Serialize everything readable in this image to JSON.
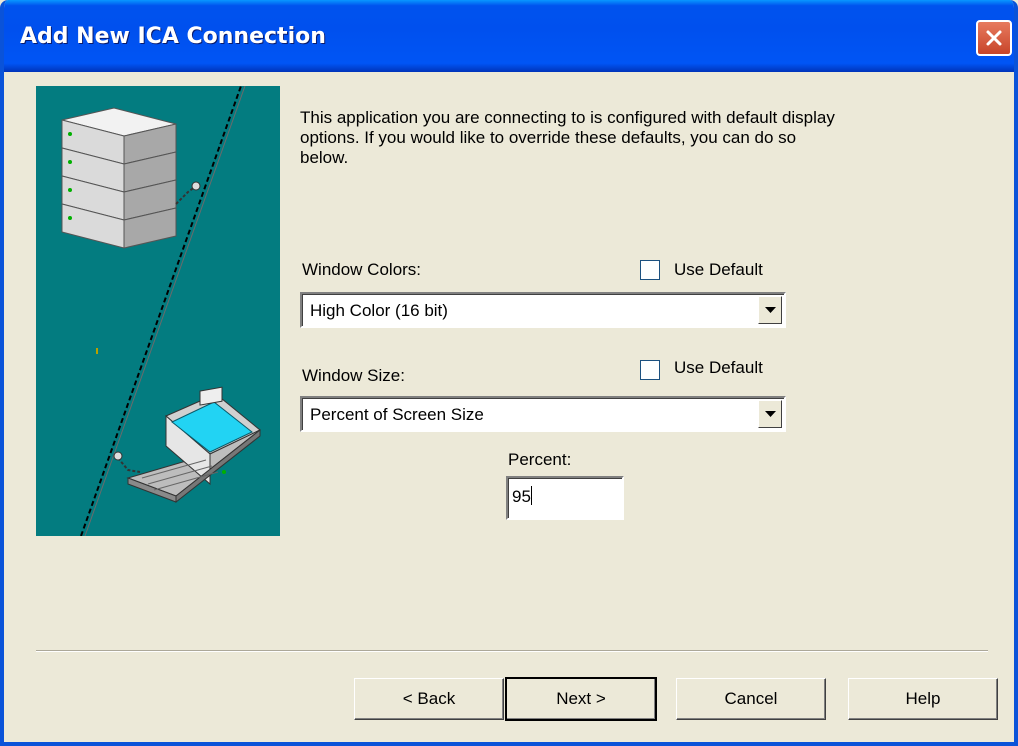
{
  "window": {
    "title": "Add New ICA Connection"
  },
  "description": "This application you are connecting to is configured with default display options.  If you would like to override these defaults, you can do so below.",
  "colors": {
    "label": "Window Colors:",
    "use_default_label": "Use Default",
    "use_default_checked": false,
    "value": "High Color (16 bit)"
  },
  "size": {
    "label": "Window Size:",
    "use_default_label": "Use Default",
    "use_default_checked": false,
    "value": "Percent of Screen Size"
  },
  "percent": {
    "label": "Percent:",
    "value": "95"
  },
  "buttons": {
    "back": "< Back",
    "next": "Next >",
    "cancel": "Cancel",
    "help": "Help"
  },
  "colors_palette": {
    "titlebar": "#0054E3",
    "dialog_bg": "#ECE9D8",
    "illustration_bg": "#037C80"
  }
}
